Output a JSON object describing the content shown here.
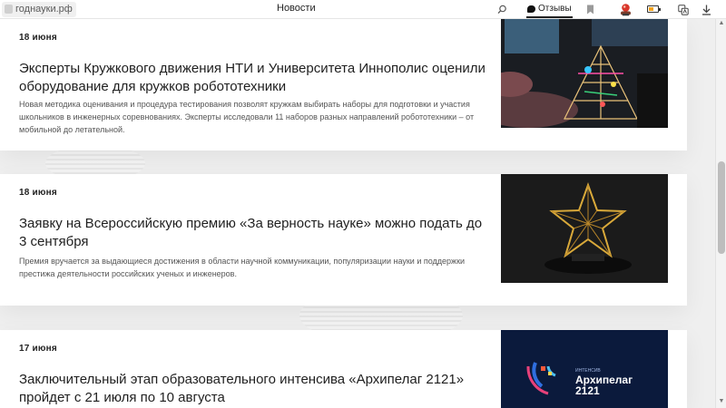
{
  "browser": {
    "domain": "годнауки.рф",
    "page_title": "Новости",
    "reviews_label": "Отзывы",
    "icons": [
      "search-icon",
      "bookmark-icon",
      "avatar-icon",
      "battery-icon",
      "translate-icon",
      "download-icon"
    ]
  },
  "news": [
    {
      "date": "18 июня",
      "title": "Эксперты Кружкового движения НТИ и Университета Иннополис оценили оборудование для кружков робототехники",
      "description": "Новая методика оценивания и процедура тестирования позволят кружкам выбирать наборы для подготовки и участия школьников в инженерных соревнованиях. Эксперты исследовали 11 наборов разных направлений робототехники – от мобильной до летательной.",
      "image": "robotics-photo"
    },
    {
      "date": "18 июня",
      "title": "Заявку на Всероссийскую премию «За верность науке» можно подать до 3 сентября",
      "description": "Премия вручается за выдающиеся достижения в области научной коммуникации, популяризации науки и поддержки престижа деятельности российских ученых и инженеров.",
      "image": "gold-star-award"
    },
    {
      "date": "17 июня",
      "title": "Заключительный этап образовательного интенсива «Архипелаг 2121» пройдет с 21 июля по 10 августа",
      "image": "archipelago-logo",
      "logo_small": "ИНТЕНСИВ",
      "logo_line1": "Архипелаг",
      "logo_line2": "2121"
    }
  ],
  "colors": {
    "accent_blue": "#0b1a3c",
    "battery_fill": "#f5a21b"
  }
}
